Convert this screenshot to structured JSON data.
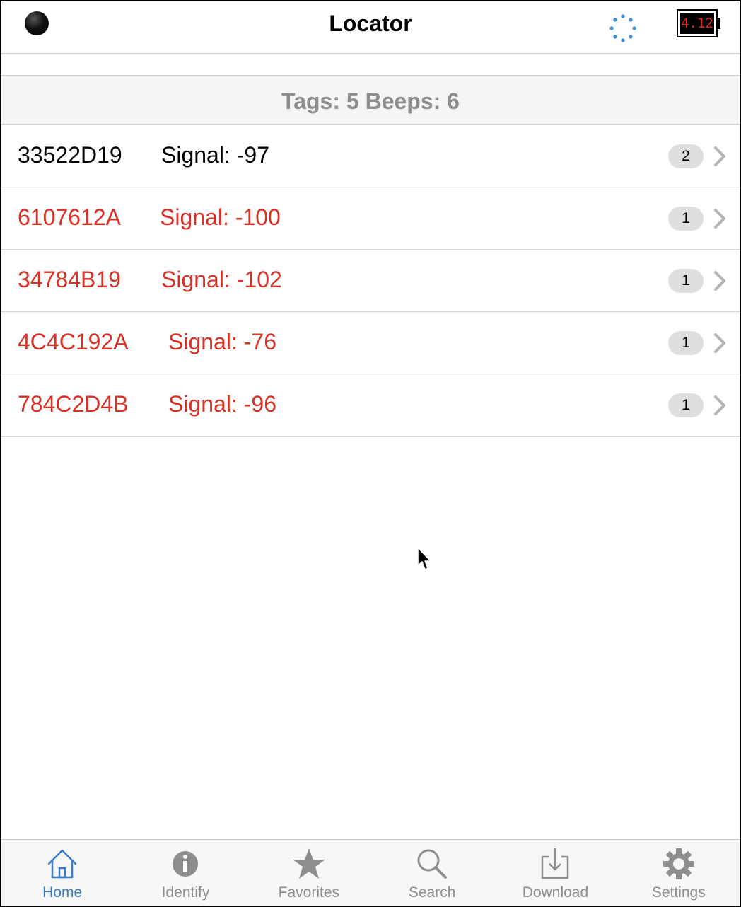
{
  "header": {
    "title": "Locator",
    "battery_value": "4.12"
  },
  "summary": {
    "text": "Tags: 5 Beeps: 6"
  },
  "tags": [
    {
      "id": "33522D19",
      "signal": "Signal: -97",
      "count": "2"
    },
    {
      "id": "6107612A",
      "signal": "Signal: -100",
      "count": "1"
    },
    {
      "id": "34784B19",
      "signal": "Signal: -102",
      "count": "1"
    },
    {
      "id": "4C4C192A",
      "signal": "Signal: -76",
      "count": "1"
    },
    {
      "id": "784C2D4B",
      "signal": "Signal: -96",
      "count": "1"
    }
  ],
  "tabs": [
    {
      "label": "Home",
      "icon": "home-icon"
    },
    {
      "label": "Identify",
      "icon": "info-icon"
    },
    {
      "label": "Favorites",
      "icon": "star-icon"
    },
    {
      "label": "Search",
      "icon": "search-icon"
    },
    {
      "label": "Download",
      "icon": "download-icon"
    },
    {
      "label": "Settings",
      "icon": "gear-icon"
    }
  ],
  "colors": {
    "accent": "#3a7cc8",
    "alert": "#d93025",
    "inactive": "#8e8e8e",
    "battery_text": "#e8281e"
  }
}
